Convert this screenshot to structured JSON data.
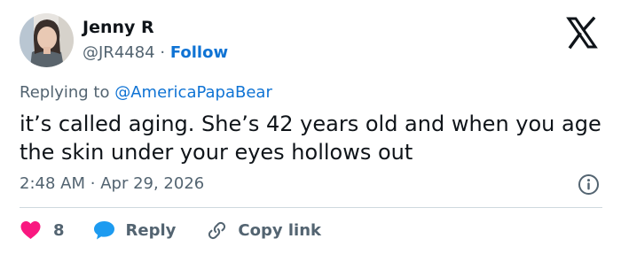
{
  "author": {
    "name": "Jenny R",
    "handle": "@JR4484",
    "separator": "·",
    "follow_label": "Follow"
  },
  "reply_context": {
    "prefix": "Replying to",
    "mention": "@AmericaPapaBear"
  },
  "tweet_text": "it’s called aging. She’s 42 years old and when you age the skin under your eyes hollows out",
  "meta": {
    "time": "2:48 AM",
    "separator": "·",
    "date": "Apr 29, 2026"
  },
  "actions": {
    "like_count": "8",
    "reply_label": "Reply",
    "copy_label": "Copy link"
  },
  "icons": {
    "logo": "x-logo-icon",
    "info": "info-icon",
    "like": "heart-icon",
    "reply": "speech-bubble-icon",
    "copy": "link-icon"
  },
  "colors": {
    "text": "#0f1419",
    "secondary": "#536471",
    "link": "#0f73d4",
    "like": "#f91880",
    "reply": "#1d9bf0",
    "divider": "#cfd9de"
  }
}
